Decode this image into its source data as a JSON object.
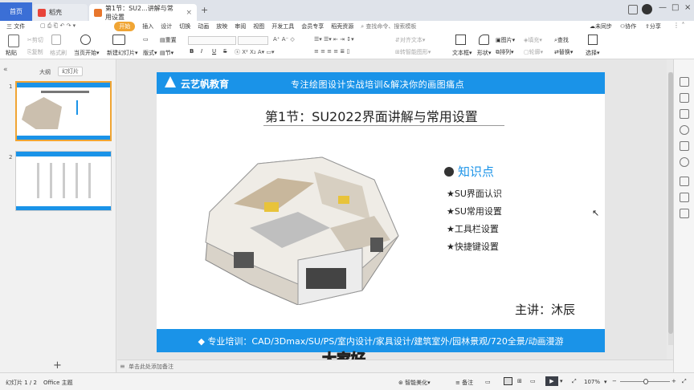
{
  "tabs": {
    "home": "首页",
    "docer": "稻壳",
    "doc": "第1节：SU2...讲解与常用设置",
    "new_tab": "+"
  },
  "menu": {
    "file": "三 文件",
    "items": [
      "开始",
      "插入",
      "设计",
      "切换",
      "动画",
      "放映",
      "审阅",
      "视图",
      "开发工具",
      "会员专享",
      "稻壳资源"
    ],
    "search": "查找命令、搜索模板",
    "sync": "未同步",
    "collab": "协作",
    "share": "分享"
  },
  "toolbar": {
    "paste": "粘贴",
    "cut": "剪切",
    "copy": "复制",
    "format_painter": "格式刷",
    "start_from_current": "当页开始",
    "new_slide": "新建幻灯片",
    "layout": "版式",
    "section": "节",
    "reset": "重置",
    "bold": "B",
    "italic": "I",
    "underline": "U",
    "strike": "S",
    "text_dir": "文字方向",
    "align_text": "对齐文本",
    "smartart": "转智能图形",
    "textbox": "文本框",
    "shape": "形状",
    "picture": "图片",
    "fill": "填充",
    "arrange": "排列",
    "outline": "轮廓",
    "find": "查找",
    "replace": "替换",
    "select": "选择"
  },
  "left_panel": {
    "outline_tab": "大纲",
    "slides_tab": "幻灯片",
    "slide_numbers": [
      "1",
      "2"
    ],
    "add": "+"
  },
  "slide": {
    "brand": "云艺帆教育",
    "tagline": "专注绘图设计实战培训&解决你的画图痛点",
    "title": "第1节：SU2022界面讲解与常用设置",
    "kp_heading": "知识点",
    "kp_items": [
      "★SU界面认识",
      "★SU常用设置",
      "★工具栏设置",
      "★快捷键设置"
    ],
    "lecturer": "主讲：沐辰",
    "footer": "◆ 专业培训：CAD/3Dmax/SU/PS/室内设计/家具设计/建筑室外/园林景观/720全景/动画漫游"
  },
  "subtitle": "大家好",
  "notes_placeholder": "单击此处添加备注",
  "status": {
    "slide_count": "幻灯片 1 / 2",
    "theme": "Office 主题",
    "beautify": "智能美化",
    "notes": "备注",
    "zoom": "107%"
  },
  "colors": {
    "accent_orange": "#f0a534",
    "slide_blue": "#1a93e8",
    "tab_blue": "#3b6fd6"
  }
}
